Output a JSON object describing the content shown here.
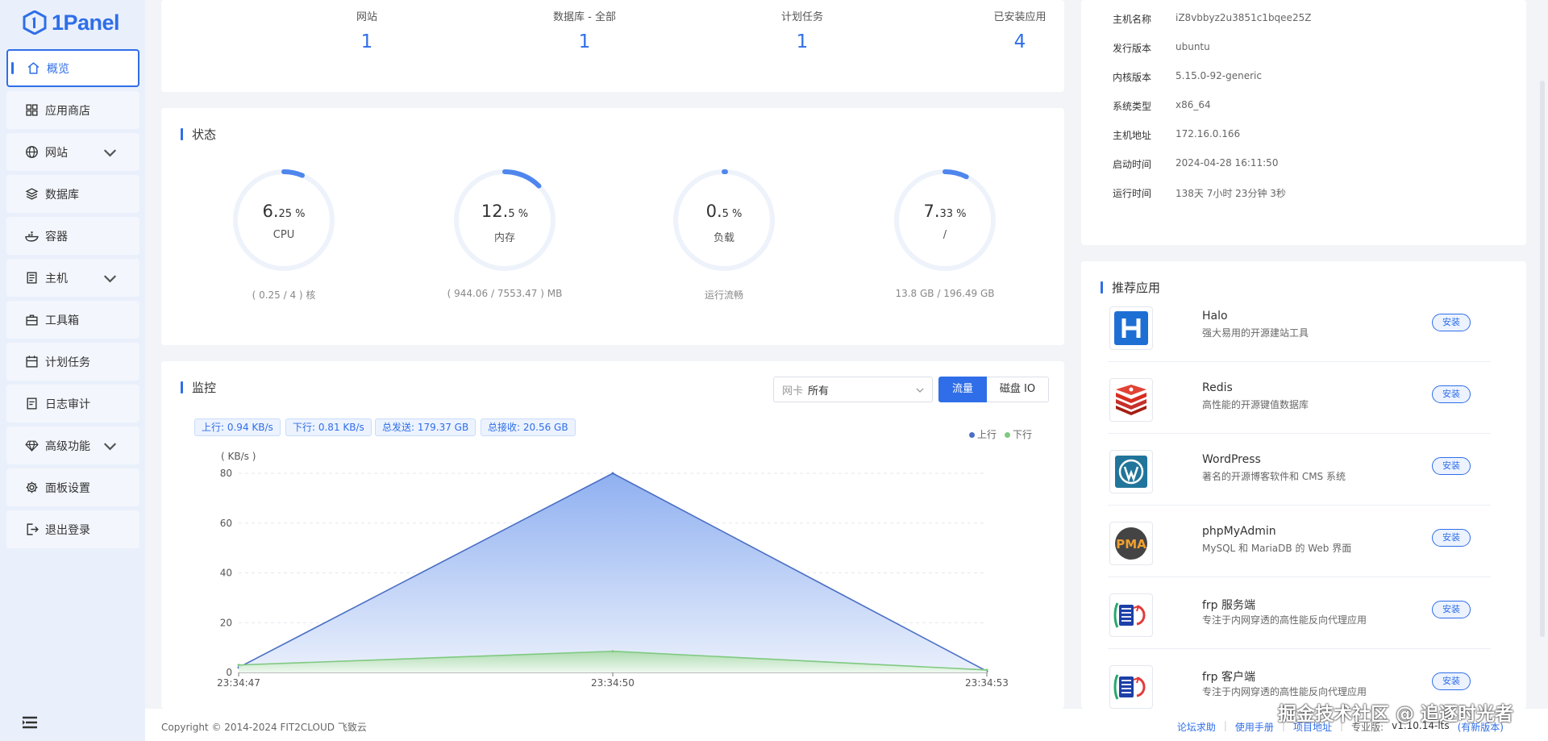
{
  "app": {
    "logo_text": "1Panel"
  },
  "sidebar": {
    "items": [
      {
        "label": "概览",
        "icon": "home-icon",
        "active": true
      },
      {
        "label": "应用商店",
        "icon": "grid-icon"
      },
      {
        "label": "网站",
        "icon": "globe-icon",
        "expandable": true
      },
      {
        "label": "数据库",
        "icon": "database-icon"
      },
      {
        "label": "容器",
        "icon": "container-icon"
      },
      {
        "label": "主机",
        "icon": "server-icon",
        "expandable": true
      },
      {
        "label": "工具箱",
        "icon": "toolbox-icon"
      },
      {
        "label": "计划任务",
        "icon": "calendar-icon"
      },
      {
        "label": "日志审计",
        "icon": "log-icon"
      },
      {
        "label": "高级功能",
        "icon": "diamond-icon",
        "expandable": true
      },
      {
        "label": "面板设置",
        "icon": "gear-icon"
      },
      {
        "label": "退出登录",
        "icon": "logout-icon"
      }
    ]
  },
  "overview": {
    "stats": [
      {
        "label": "网站",
        "value": "1"
      },
      {
        "label": "数据库 - 全部",
        "value": "1"
      },
      {
        "label": "计划任务",
        "value": "1"
      },
      {
        "label": "已安装应用",
        "value": "4"
      }
    ]
  },
  "status": {
    "title": "状态",
    "gauges": [
      {
        "int": "6.",
        "dec": "25 %",
        "name": "CPU",
        "foot": "( 0.25 / 4 ) 核",
        "percent": 6.25
      },
      {
        "int": "12.",
        "dec": "5 %",
        "name": "内存",
        "foot": "( 944.06 / 7553.47 ) MB",
        "percent": 12.5
      },
      {
        "int": "0.",
        "dec": "5 %",
        "name": "负载",
        "foot": "运行流畅",
        "percent": 0.5
      },
      {
        "int": "7.",
        "dec": "33 %",
        "name": "/",
        "foot": "13.8 GB / 196.49 GB",
        "percent": 7.33
      }
    ]
  },
  "monitor": {
    "title": "监控",
    "chips": [
      "上行: 0.94 KB/s",
      "下行: 0.81 KB/s",
      "总发送: 179.37 GB",
      "总接收: 20.56 GB"
    ],
    "select_prefix": "网卡",
    "select_value": "所有",
    "tab_traffic": "流量",
    "tab_disk": "磁盘 IO",
    "legend": [
      "上行",
      "下行"
    ]
  },
  "chart_data": {
    "type": "area",
    "x": [
      "23:34:47",
      "23:34:50",
      "23:34:53"
    ],
    "ylabel": "( KB/s )",
    "ylim": [
      0,
      80
    ],
    "yticks": [
      0,
      20,
      40,
      60,
      80
    ],
    "series": [
      {
        "name": "上行",
        "values": [
          2,
          80,
          0.5
        ],
        "color": "#4a6fc4"
      },
      {
        "name": "下行",
        "values": [
          3,
          8.5,
          1
        ],
        "color": "#7fc97f"
      }
    ]
  },
  "host_info": [
    {
      "key": "主机名称",
      "value": "iZ8vbbyz2u3851c1bqee25Z"
    },
    {
      "key": "发行版本",
      "value": "ubuntu"
    },
    {
      "key": "内核版本",
      "value": "5.15.0-92-generic"
    },
    {
      "key": "系统类型",
      "value": "x86_64"
    },
    {
      "key": "主机地址",
      "value": "172.16.0.166"
    },
    {
      "key": "启动时间",
      "value": "2024-04-28 16:11:50"
    },
    {
      "key": "运行时间",
      "value": "138天 7小时 23分钟 3秒"
    }
  ],
  "recommend": {
    "title": "推荐应用",
    "install_label": "安装",
    "apps": [
      {
        "name": "Halo",
        "desc": "强大易用的开源建站工具",
        "icon": "halo-icon"
      },
      {
        "name": "Redis",
        "desc": "高性能的开源键值数据库",
        "icon": "redis-icon"
      },
      {
        "name": "WordPress",
        "desc": "著名的开源博客软件和 CMS 系统",
        "icon": "wordpress-icon"
      },
      {
        "name": "phpMyAdmin",
        "desc": "MySQL 和 MariaDB 的 Web 界面",
        "icon": "phpmyadmin-icon"
      },
      {
        "name": "frp 服务端",
        "desc": "专注于内网穿透的高性能反向代理应用",
        "icon": "frp-icon"
      },
      {
        "name": "frp 客户端",
        "desc": "专注于内网穿透的高性能反向代理应用",
        "icon": "frp-icon"
      }
    ]
  },
  "footer": {
    "copyright": "Copyright © 2014-2024 FIT2CLOUD 飞致云",
    "links": [
      "论坛求助",
      "使用手册",
      "项目地址"
    ],
    "edition": "专业版:",
    "version": "v1.10.14-lts",
    "new_version": "(有新版本)"
  },
  "watermark": "掘金技术社区 @ 追逐时光者"
}
